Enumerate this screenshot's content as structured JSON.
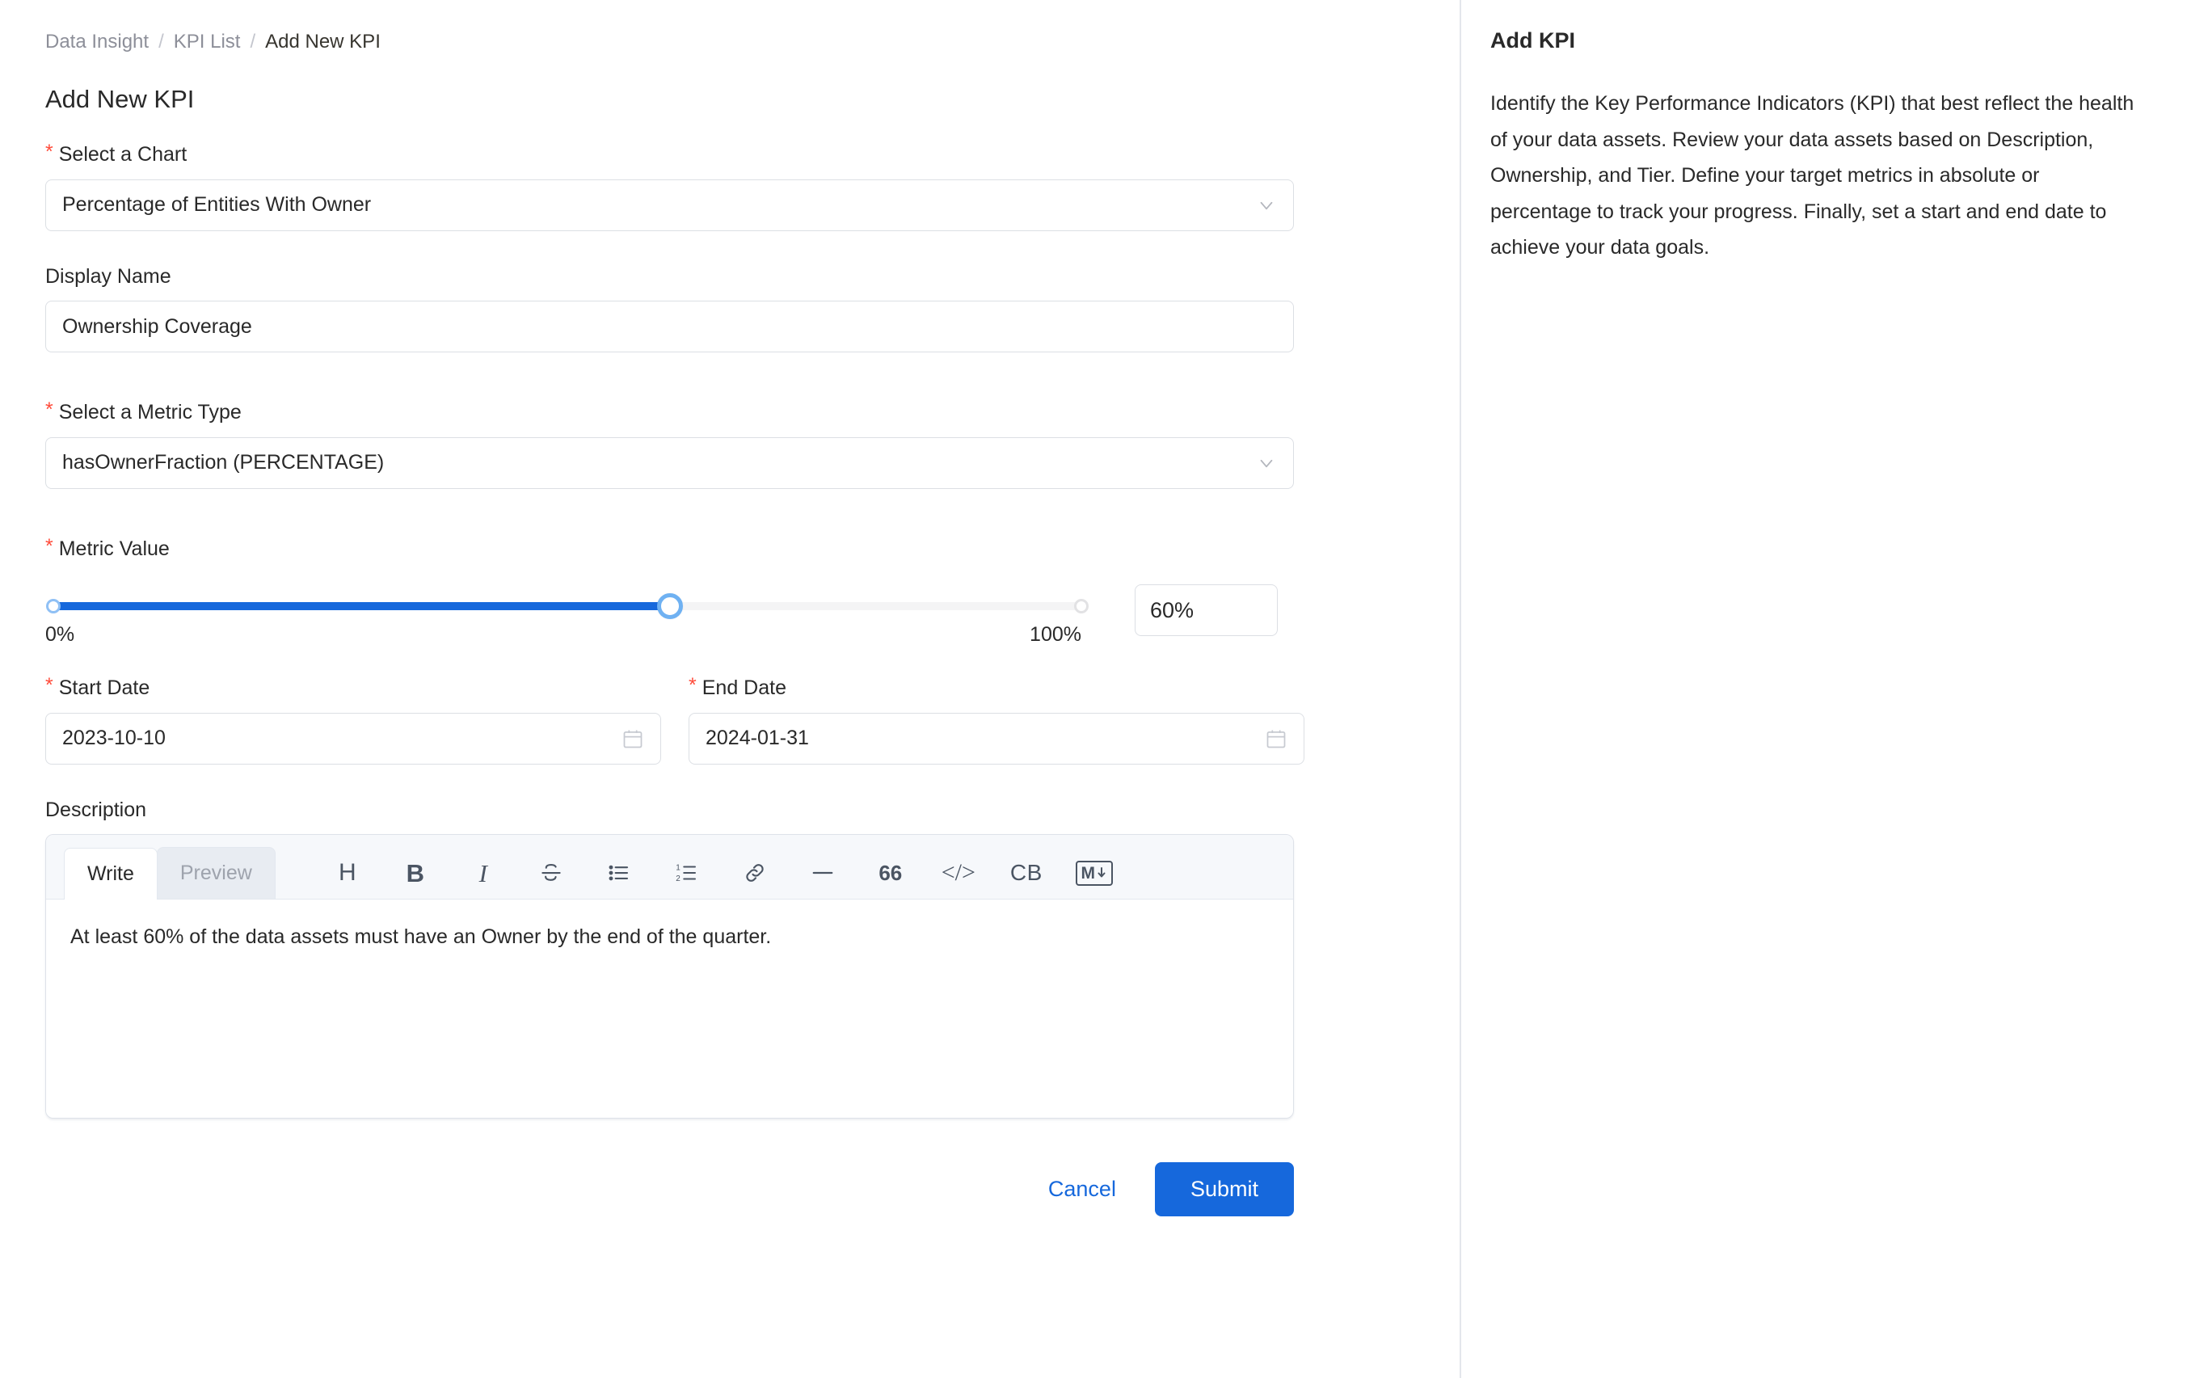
{
  "breadcrumb": {
    "items": [
      "Data Insight",
      "KPI List",
      "Add New KPI"
    ],
    "separator": "/"
  },
  "page": {
    "title": "Add New KPI"
  },
  "form": {
    "chart": {
      "label": "Select a Chart",
      "required_marker": "*",
      "value": "Percentage of Entities With Owner"
    },
    "display_name": {
      "label": "Display Name",
      "value": "Ownership Coverage"
    },
    "metric_type": {
      "label": "Select a Metric Type",
      "required_marker": "*",
      "value": "hasOwnerFraction (PERCENTAGE)"
    },
    "metric_value": {
      "label": "Metric Value",
      "required_marker": "*",
      "min_label": "0%",
      "max_label": "100%",
      "min": 0,
      "max": 100,
      "value": 60,
      "value_text": "60%",
      "fill_color": "#1668dc"
    },
    "start_date": {
      "label": "Start Date",
      "required_marker": "*",
      "value": "2023-10-10"
    },
    "end_date": {
      "label": "End Date",
      "required_marker": "*",
      "value": "2024-01-31"
    },
    "description": {
      "label": "Description",
      "tabs": [
        {
          "label": "Write",
          "active": true
        },
        {
          "label": "Preview",
          "active": false
        }
      ],
      "toolbar": [
        {
          "name": "heading-icon",
          "glyph": "H"
        },
        {
          "name": "bold-icon",
          "glyph": "B"
        },
        {
          "name": "italic-icon",
          "glyph": "I"
        },
        {
          "name": "strikethrough-icon",
          "glyph": "S"
        },
        {
          "name": "bullet-list-icon",
          "glyph": ""
        },
        {
          "name": "ordered-list-icon",
          "glyph": ""
        },
        {
          "name": "link-icon",
          "glyph": ""
        },
        {
          "name": "horizontal-rule-icon",
          "glyph": ""
        },
        {
          "name": "blockquote-icon",
          "glyph": "66"
        },
        {
          "name": "inline-code-icon",
          "glyph": "</>"
        },
        {
          "name": "code-block-icon",
          "glyph": "CB"
        },
        {
          "name": "markdown-icon",
          "glyph": "M"
        }
      ],
      "content": "At least 60% of the data assets must have an Owner by the end of the quarter."
    }
  },
  "actions": {
    "cancel_label": "Cancel",
    "submit_label": "Submit",
    "primary_color": "#1668dc"
  },
  "right_panel": {
    "title": "Add KPI",
    "body": "Identify the Key Performance Indicators (KPI) that best reflect the health of your data assets. Review your data assets based on Description, Ownership, and Tier. Define your target metrics in absolute or percentage to track your progress. Finally, set a start and end date to achieve your data goals."
  }
}
